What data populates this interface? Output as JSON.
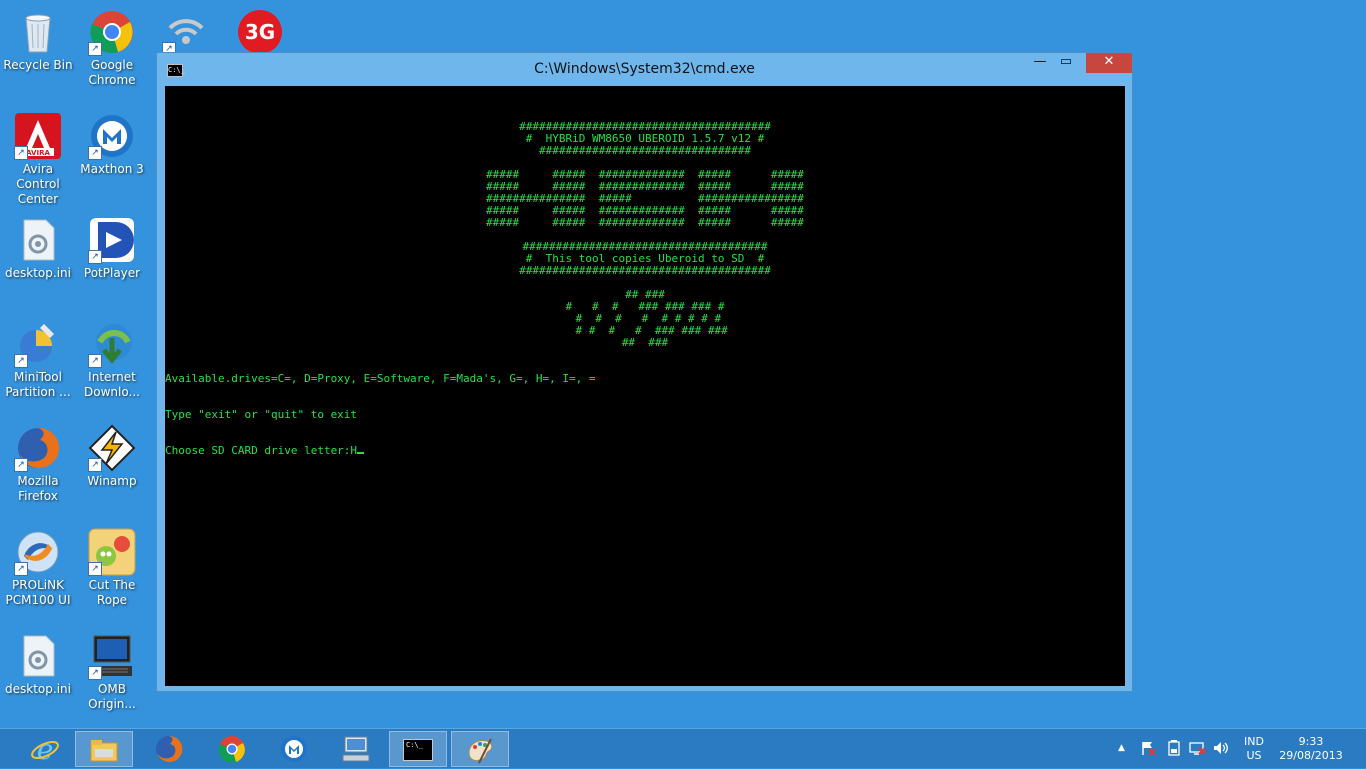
{
  "desktop": {
    "icons": [
      {
        "label": "Recycle Bin",
        "icon": "recycle-bin-icon"
      },
      {
        "label": "Google Chrome",
        "icon": "chrome-icon"
      },
      {
        "label": "Avira Control Center",
        "icon": "avira-icon"
      },
      {
        "label": "Maxthon 3",
        "icon": "maxthon-icon"
      },
      {
        "label": "desktop.ini",
        "icon": "settings-file-icon"
      },
      {
        "label": "PotPlayer",
        "icon": "potplayer-icon"
      },
      {
        "label": "MiniTool Partition ...",
        "icon": "minitool-icon"
      },
      {
        "label": "Internet Downlo...",
        "icon": "internet-download-manager-icon"
      },
      {
        "label": "Mozilla Firefox",
        "icon": "firefox-icon"
      },
      {
        "label": "Winamp",
        "icon": "winamp-icon"
      },
      {
        "label": "PROLiNK PCM100 UI",
        "icon": "prolink-icon"
      },
      {
        "label": "Cut The Rope",
        "icon": "cut-the-rope-icon"
      },
      {
        "label": "desktop.ini",
        "icon": "settings-file-icon"
      },
      {
        "label": "OMB Origin...",
        "icon": "omb-computer-icon"
      }
    ],
    "partial_icons": [
      {
        "label": "",
        "icon": "wireless-icon"
      },
      {
        "label": "3G",
        "icon": "3g-modem-icon"
      }
    ]
  },
  "window": {
    "title": "C:\\Windows\\System32\\cmd.exe",
    "icon_text": "C:\\_",
    "minimize": "—",
    "maximize": "▭",
    "close": "✕"
  },
  "console": {
    "banner": [
      "######################################",
      "#  HYBRiD WM8650 UBEROID 1.5.7 v12 #",
      "################################",
      "",
      "#####     #####  #############  #####      #####",
      "#####     #####  #############  #####      #####",
      "###############  #####          ################",
      "#####     #####  #############  #####      #####",
      "#####     #####  #############  #####      #####",
      "",
      "#####################################",
      "#  This tool copies Uberoid to SD  #",
      "######################################",
      "",
      "## ###",
      "#   #  #   ### ### ### #",
      " #  #  #   #  # # # # #",
      "  # #  #   #  ### ### ###",
      "##  ###"
    ],
    "lines": [
      "Available.drives=C=, D=Proxy, E=Software, F=Mada's, G=, H=, I=, =",
      "Type \"exit\" or \"quit\" to exit",
      "Choose SD CARD drive letter:H"
    ],
    "text_color": "#27e047",
    "background": "#000000"
  },
  "taskbar": {
    "apps": [
      {
        "icon": "internet-explorer-icon",
        "active": false
      },
      {
        "icon": "file-explorer-icon",
        "active": true
      },
      {
        "icon": "firefox-icon",
        "active": false
      },
      {
        "icon": "chrome-icon",
        "active": false
      },
      {
        "icon": "maxthon-icon",
        "active": false
      },
      {
        "icon": "network-computer-icon",
        "active": false
      },
      {
        "icon": "cmd-icon",
        "active": true
      },
      {
        "icon": "paint-icon",
        "active": true
      }
    ],
    "tray": {
      "show_hidden": "▲",
      "language_line1": "IND",
      "language_line2": "US",
      "time": "9:33",
      "date": "29/08/2013"
    },
    "color": "#2a7bc1"
  }
}
